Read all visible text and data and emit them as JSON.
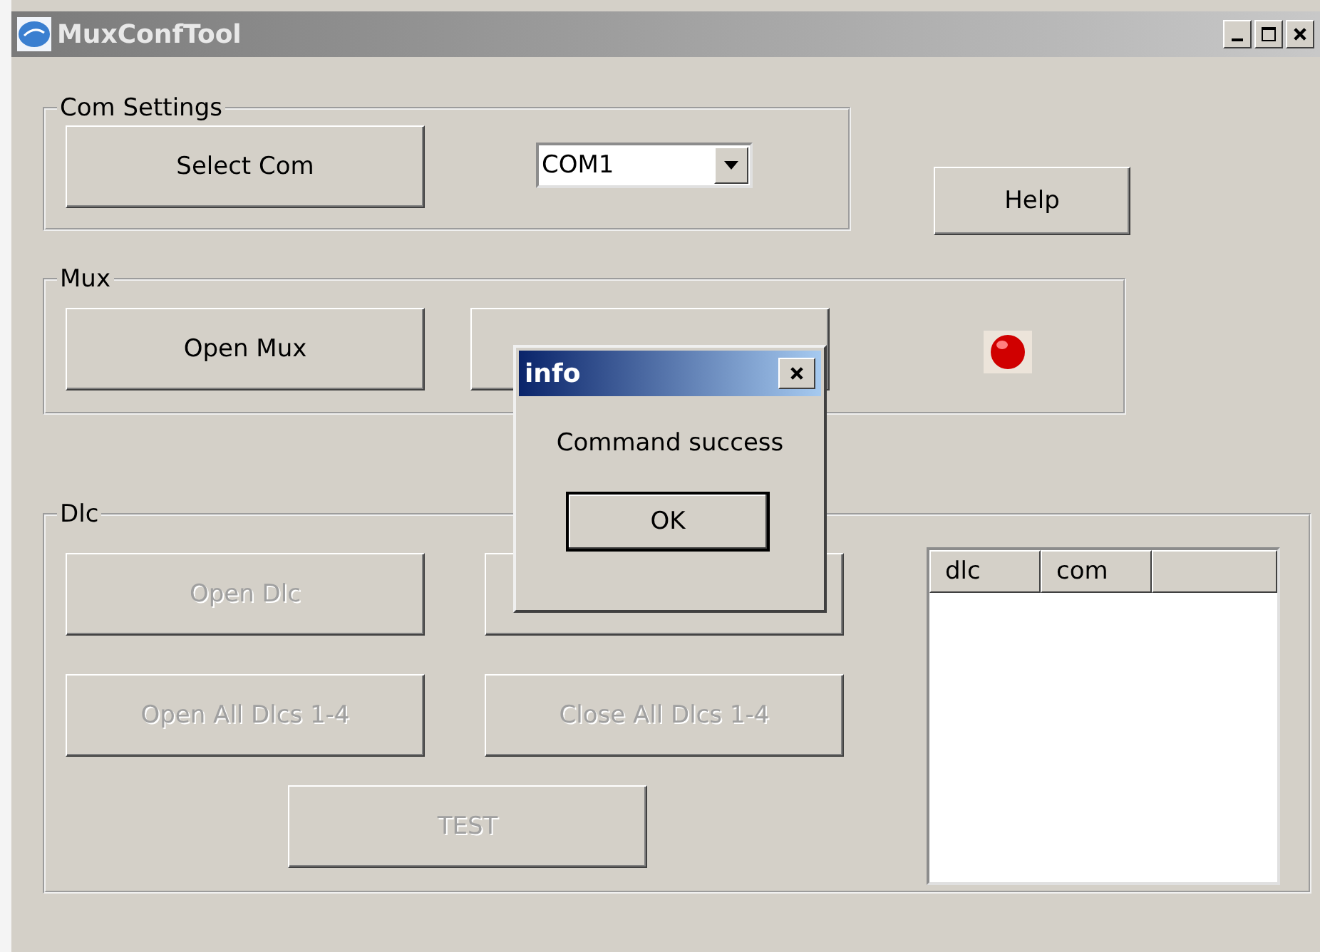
{
  "window": {
    "title": "MuxConfTool"
  },
  "com_settings": {
    "legend": "Com Settings",
    "select_button": {
      "label": "Select Com",
      "disabled": false
    },
    "port": {
      "value": "COM1"
    }
  },
  "help_button": {
    "label": "Help",
    "disabled": false
  },
  "mux": {
    "legend": "Mux",
    "buttons": [
      {
        "label": "Open Mux",
        "disabled": false
      }
    ],
    "indicator": {
      "on": true
    }
  },
  "dlc": {
    "legend": "Dlc",
    "buttons": [
      {
        "label": "Open Dlc",
        "disabled": true
      },
      {
        "label": "Open All Dlcs 1-4",
        "disabled": true
      },
      {
        "label": "Close All Dlcs 1-4",
        "disabled": true
      },
      {
        "label": "TEST",
        "disabled": true
      }
    ],
    "list": {
      "columns": [
        "dlc",
        "com"
      ]
    }
  },
  "dialog": {
    "title": "info",
    "message": "Command success",
    "button": "OK"
  }
}
